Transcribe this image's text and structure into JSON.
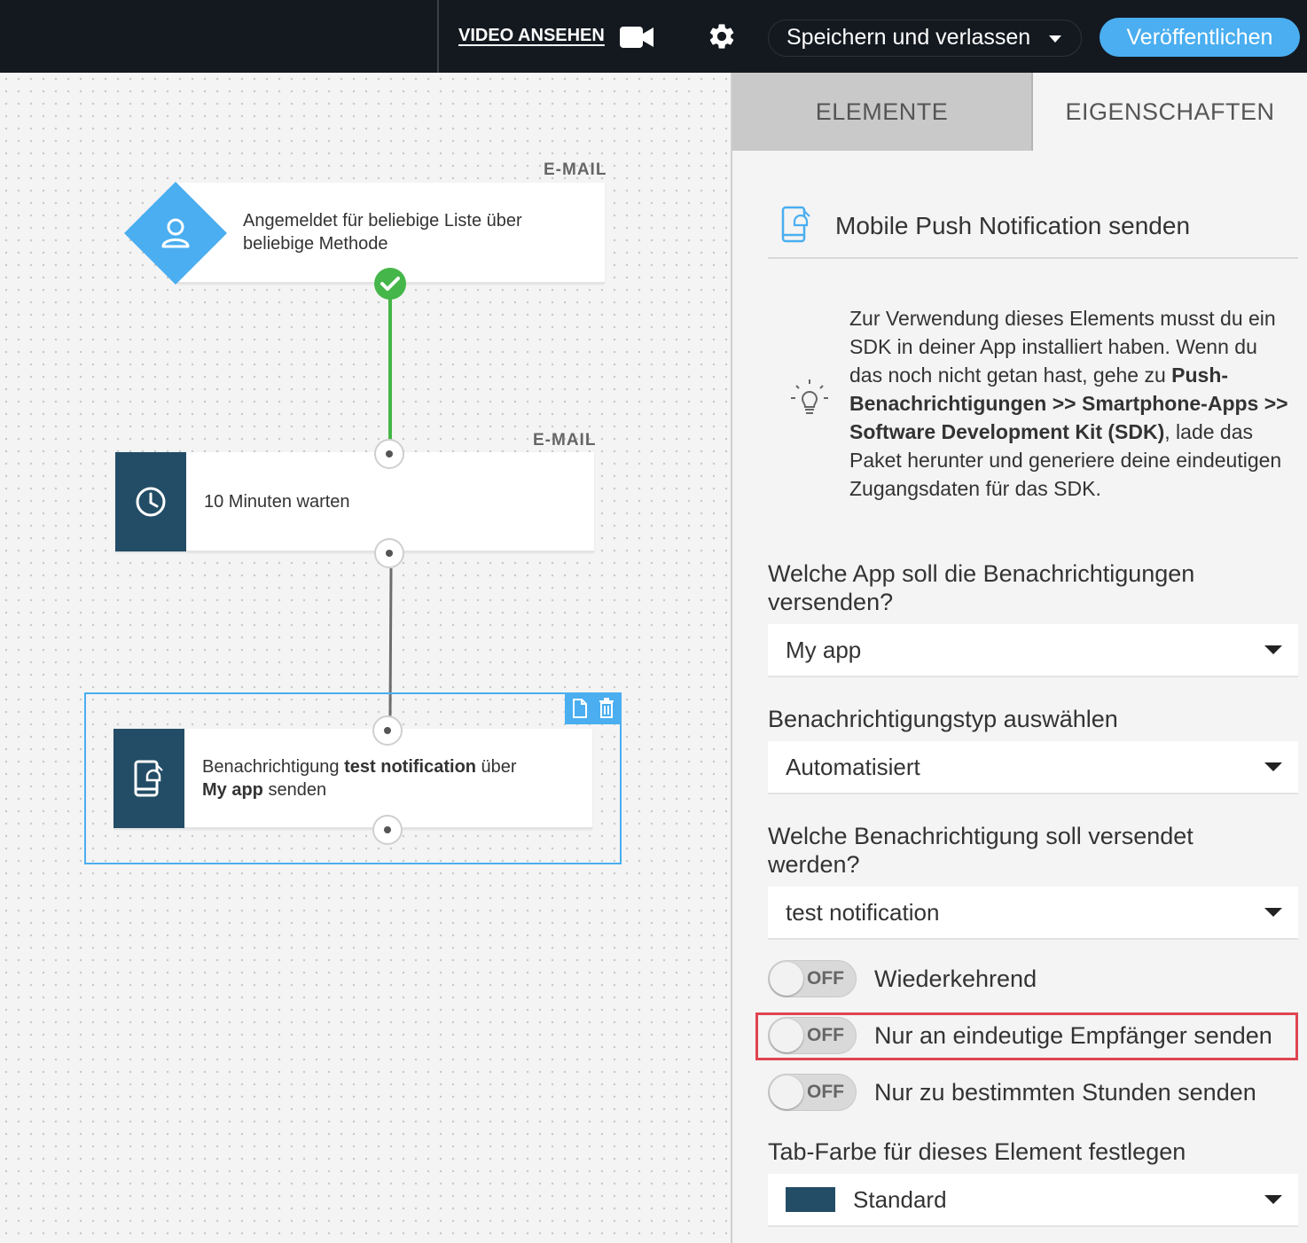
{
  "topbar": {
    "video_label": "VIDEO ANSEHEN",
    "save_label": "Speichern und verlassen",
    "publish_label": "Veröffentlichen"
  },
  "workflow": {
    "node1": {
      "category": "E-MAIL",
      "text": "Angemeldet für beliebige Liste über beliebige Methode",
      "icon": "user-icon"
    },
    "node2": {
      "category": "E-MAIL",
      "text": "10 Minuten warten",
      "icon": "clock-icon"
    },
    "node3": {
      "text_prefix": "Benachrichtigung ",
      "notification_name": "test notification",
      "text_middle": " über",
      "app_name": "My app",
      "text_suffix": " senden",
      "icon": "mobile-push-icon"
    }
  },
  "panel": {
    "tabs": [
      "ELEMENTE",
      "EIGENSCHAFTEN"
    ],
    "active_tab": "EIGENSCHAFTEN",
    "title": "Mobile Push Notification senden",
    "info": {
      "part1": "Zur Verwendung dieses Elements musst du ein SDK in deiner App installiert haben. Wenn du das noch nicht getan hast, gehe zu ",
      "bold": "Push-Benachrichtigungen >> Smartphone-Apps >> Software Development Kit (SDK)",
      "part2": ", lade das Paket herunter und generiere deine eindeutigen Zugangsdaten für das SDK."
    },
    "app_label": "Welche App soll die Benachrichtigungen versenden?",
    "app_value": "My app",
    "type_label": "Benachrichtigungstyp auswählen",
    "type_value": "Automatisiert",
    "notification_label": "Welche Benachrichtigung soll versendet werden?",
    "notification_value": "test notification",
    "toggles": [
      {
        "state": "OFF",
        "label": "Wiederkehrend"
      },
      {
        "state": "OFF",
        "label": "Nur an eindeutige Empfänger senden",
        "highlighted": true
      },
      {
        "state": "OFF",
        "label": "Nur zu bestimmten Stunden senden"
      }
    ],
    "tab_color_label": "Tab-Farbe für dieses Element festlegen",
    "tab_color_value": "Standard",
    "tab_color_swatch": "#234d66"
  },
  "colors": {
    "accent": "#4aaef0",
    "topbar": "#141920",
    "node_dark": "#234d66",
    "success": "#45b649",
    "highlight": "#e04450"
  }
}
